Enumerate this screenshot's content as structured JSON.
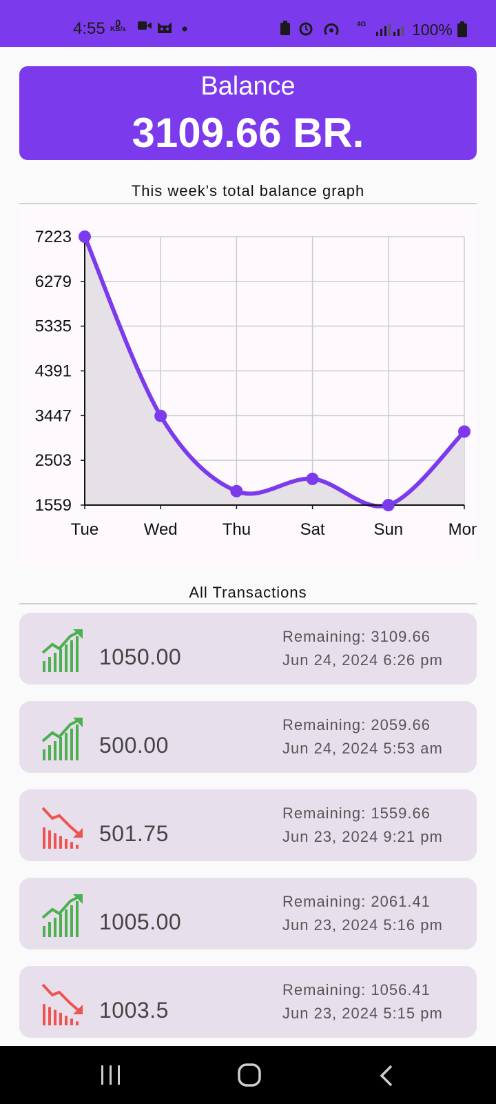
{
  "status_bar": {
    "time": "4:55",
    "net_speed_value": "0",
    "net_speed_unit": "KB/s",
    "network": "4G",
    "battery": "100%"
  },
  "balance": {
    "label": "Balance",
    "amount": "3109.66 BR."
  },
  "graph_section": {
    "title": "This week's total balance graph"
  },
  "chart_data": {
    "type": "area",
    "categories": [
      "Tue",
      "Wed",
      "Thu",
      "Sat",
      "Sun",
      "Mon"
    ],
    "values": [
      7223,
      3441,
      1853,
      2112,
      1559,
      3110
    ],
    "y_ticks": [
      "7223",
      "6279",
      "5335",
      "4391",
      "3447",
      "2503",
      "1559"
    ],
    "ylim": [
      1559,
      7223
    ],
    "grid": true,
    "title": "",
    "xlabel": "",
    "ylabel": ""
  },
  "transactions_section": {
    "title": "All Transactions"
  },
  "transactions": [
    {
      "direction": "up",
      "icon": "chart-up-icon",
      "amount": "1050.00",
      "remaining": "Remaining: 3109.66",
      "date": "Jun 24, 2024 6:26 pm"
    },
    {
      "direction": "up",
      "icon": "chart-up-icon",
      "amount": "500.00",
      "remaining": "Remaining: 2059.66",
      "date": "Jun 24, 2024 5:53 am"
    },
    {
      "direction": "down",
      "icon": "chart-down-icon",
      "amount": "501.75",
      "remaining": "Remaining: 1559.66",
      "date": "Jun 23, 2024 9:21 pm"
    },
    {
      "direction": "up",
      "icon": "chart-up-icon",
      "amount": "1005.00",
      "remaining": "Remaining: 2061.41",
      "date": "Jun 23, 2024 5:16 pm"
    },
    {
      "direction": "down",
      "icon": "chart-down-icon",
      "amount": "1003.5",
      "remaining": "Remaining: 1056.41",
      "date": "Jun 23, 2024 5:15 pm"
    }
  ],
  "colors": {
    "accent": "#7c3aed",
    "income": "#4caf50",
    "expense": "#ef5350",
    "card_bg": "#e7e0ec"
  }
}
